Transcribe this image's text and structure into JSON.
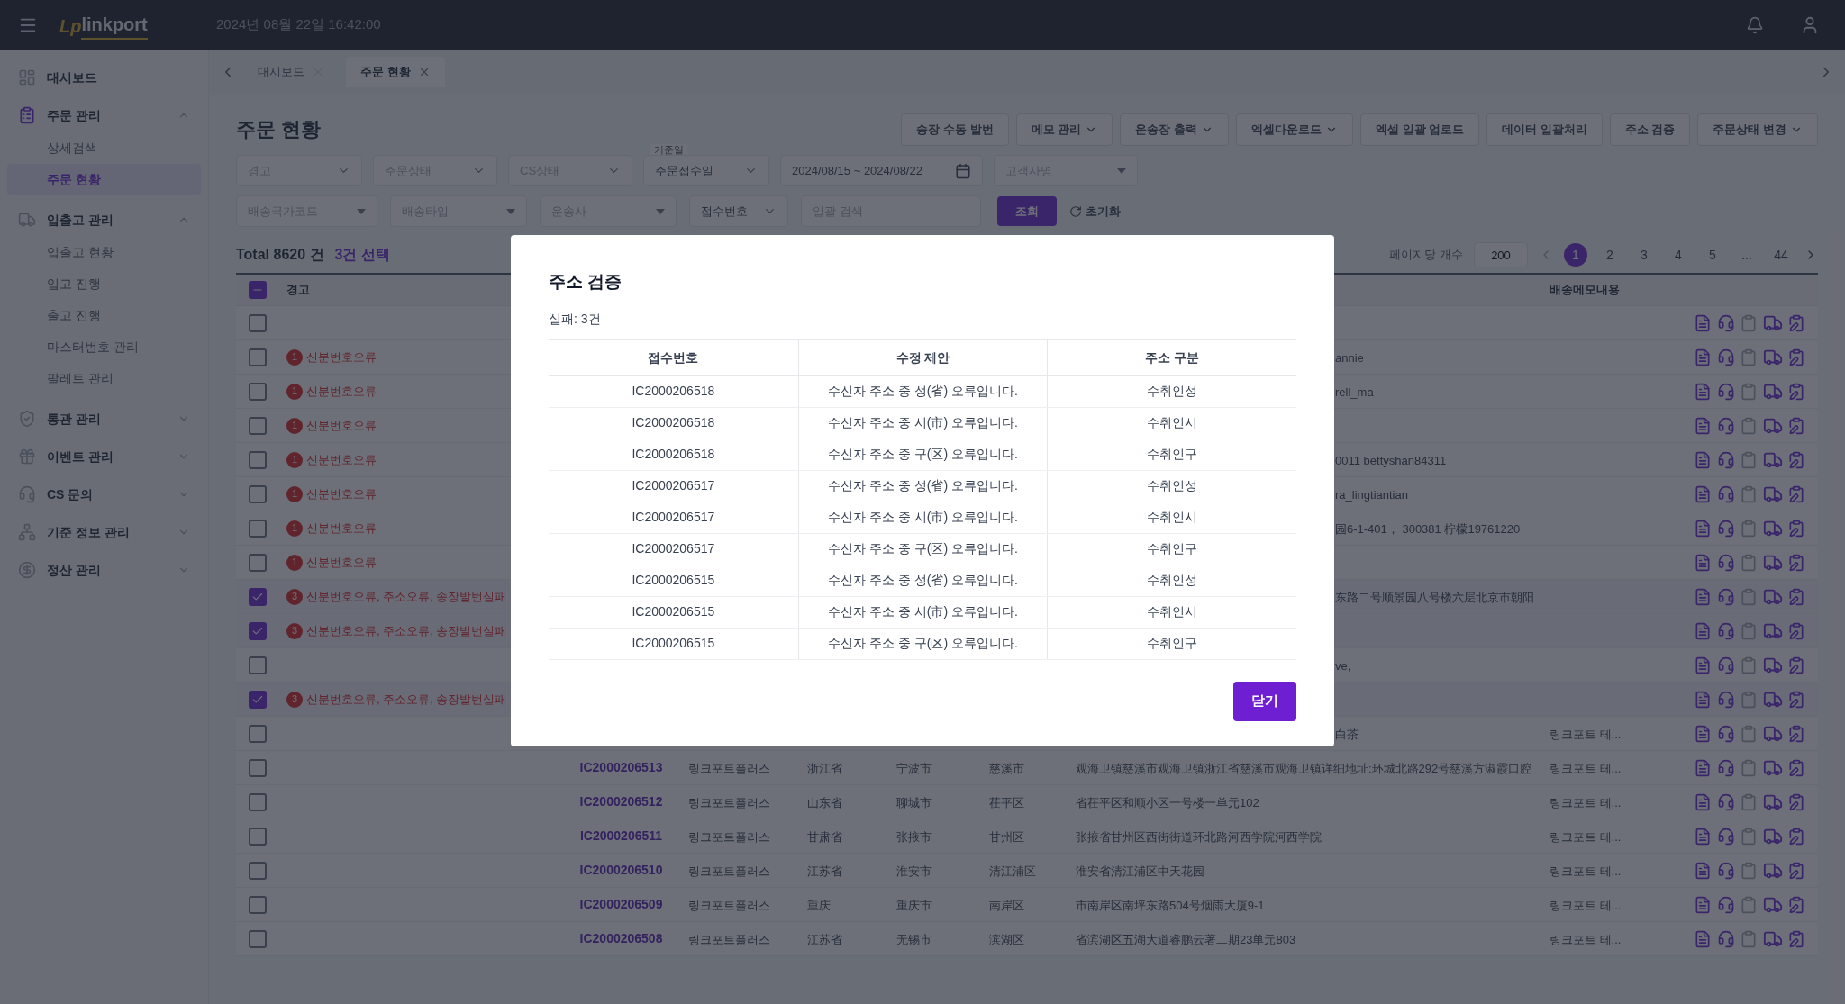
{
  "header": {
    "logo_mark": "Lp",
    "logo_name": "linkport",
    "datetime": "2024년 08월 22일 16:42:00"
  },
  "sidebar": {
    "items": [
      {
        "kind": "link",
        "label": "대시보드"
      },
      {
        "kind": "group",
        "label": "주문 관리",
        "expanded": true,
        "children": [
          {
            "label": "상세검색",
            "selected": false
          },
          {
            "label": "주문 현황",
            "selected": true
          }
        ]
      },
      {
        "kind": "group",
        "label": "입출고 관리",
        "expanded": true,
        "children": [
          {
            "label": "입출고 현황",
            "selected": false
          },
          {
            "label": "입고 진행",
            "selected": false
          },
          {
            "label": "출고 진행",
            "selected": false
          },
          {
            "label": "마스터번호 관리",
            "selected": false
          },
          {
            "label": "팔레트 관리",
            "selected": false
          }
        ]
      },
      {
        "kind": "group",
        "label": "통관 관리",
        "expanded": false
      },
      {
        "kind": "group",
        "label": "이벤트 관리",
        "expanded": false
      },
      {
        "kind": "group",
        "label": "CS 문의",
        "expanded": false
      },
      {
        "kind": "group",
        "label": "기준 정보 관리",
        "expanded": false
      },
      {
        "kind": "group",
        "label": "정산 관리",
        "expanded": false
      }
    ]
  },
  "tabs": [
    {
      "label": "대시보드",
      "selected": false
    },
    {
      "label": "주문 현황",
      "selected": true
    }
  ],
  "page_title": "주문 현황",
  "toolbar": [
    {
      "label": "송장 수동 발번",
      "menu": false
    },
    {
      "label": "메모 관리",
      "menu": true
    },
    {
      "label": "운송장 출력",
      "menu": true
    },
    {
      "label": "엑셀다운로드",
      "menu": true
    },
    {
      "label": "엑셀 일괄 업로드",
      "menu": false
    },
    {
      "label": "데이터 일괄처리",
      "menu": false
    },
    {
      "label": "주소 검증",
      "menu": false
    },
    {
      "label": "주문상태 변경",
      "menu": true
    }
  ],
  "filters_row_1": [
    {
      "kind": "select",
      "placeholder": "경고"
    },
    {
      "kind": "select",
      "placeholder": "주문상태"
    },
    {
      "kind": "select",
      "placeholder": "CS상태"
    },
    {
      "kind": "labeled",
      "label": "기준일",
      "value": "주문접수일"
    },
    {
      "kind": "date",
      "value": "2024/08/15 ~ 2024/08/22"
    },
    {
      "kind": "dropdown",
      "placeholder": "고객사명"
    }
  ],
  "filters_row_2": [
    {
      "kind": "dropdown",
      "placeholder": "배송국가코드"
    },
    {
      "kind": "dropdown",
      "placeholder": "배송타입"
    },
    {
      "kind": "dropdown",
      "placeholder": "운송사"
    },
    {
      "kind": "value",
      "value": "접수번호"
    },
    {
      "kind": "input",
      "placeholder": "일괄 검색"
    }
  ],
  "search_button": "조회",
  "reset_button": "초기화",
  "summary": {
    "total": "Total 8620 건",
    "selected": "3건 선택"
  },
  "pagination": {
    "page_size_label": "페이지당 개수",
    "page_size": "200",
    "pages": [
      {
        "label": "1",
        "selected": true
      },
      {
        "label": "2",
        "selected": false
      },
      {
        "label": "3",
        "selected": false
      },
      {
        "label": "4",
        "selected": false
      },
      {
        "label": "5",
        "selected": false
      },
      {
        "label": "...",
        "selected": false
      },
      {
        "label": "44",
        "selected": false
      }
    ]
  },
  "table": {
    "header_checkbox": {
      "indeterminate": true
    },
    "columns": {
      "warning": "경고",
      "memo": "배송메모내용"
    },
    "rows": [
      {
        "kind": "covered",
        "checked": false
      },
      {
        "kind": "covered",
        "checked": false,
        "warning": {
          "count": "1",
          "text": "신분번호오류"
        },
        "address": "annie"
      },
      {
        "kind": "covered",
        "checked": false,
        "warning": {
          "count": "1",
          "text": "신분번호오류"
        },
        "address": "rell_ma"
      },
      {
        "kind": "covered",
        "checked": false,
        "warning": {
          "count": "1",
          "text": "신분번호오류"
        }
      },
      {
        "kind": "covered",
        "checked": false,
        "warning": {
          "count": "1",
          "text": "신분번호오류"
        },
        "address": "0011 bettyshan84311"
      },
      {
        "kind": "covered",
        "checked": false,
        "warning": {
          "count": "1",
          "text": "신분번호오류"
        },
        "address": "ra_lingtiantian"
      },
      {
        "kind": "covered",
        "checked": false,
        "warning": {
          "count": "1",
          "text": "신분번호오류"
        },
        "address": "园6-1-401， 300381 柠檬19761220"
      },
      {
        "kind": "covered",
        "checked": false,
        "warning": {
          "count": "1",
          "text": "신분번호오류"
        }
      },
      {
        "kind": "covered",
        "checked": true,
        "warning": {
          "count": "3",
          "text": "신분번호오류, 주소오류, 송장발번실패"
        },
        "address": "东路二号顺景园八号楼六层北京市朝阳"
      },
      {
        "kind": "covered",
        "checked": true,
        "warning": {
          "count": "3",
          "text": "신분번호오류, 주소오류, 송장발번실패"
        }
      },
      {
        "kind": "covered",
        "checked": false,
        "address": "ve,"
      },
      {
        "kind": "covered",
        "checked": true,
        "warning": {
          "count": "3",
          "text": "신분번호오류, 주소오류, 송장발번실패"
        }
      },
      {
        "kind": "covered",
        "checked": false,
        "address": "白茶",
        "memo": "링크포트 테..."
      },
      {
        "kind": "full",
        "checked": false,
        "receipt": "IC2000206513",
        "company": "링크포트플러스",
        "province": "浙江省",
        "city": "宁波市",
        "district": "慈溪市",
        "address": "观海卫镇慈溪市观海卫镇浙江省慈溪市观海卫镇详细地址:环城北路292号慈溪方淑霞口腔",
        "memo": "링크포트 테..."
      },
      {
        "kind": "full",
        "checked": false,
        "receipt": "IC2000206512",
        "company": "링크포트플러스",
        "province": "山东省",
        "city": "聊城市",
        "district": "茌平区",
        "address": "省茌平区和顺小区一号楼一单元102",
        "memo": "링크포트 테..."
      },
      {
        "kind": "full",
        "checked": false,
        "receipt": "IC2000206511",
        "company": "링크포트플러스",
        "province": "甘肃省",
        "city": "张掖市",
        "district": "甘州区",
        "address": "张掖省甘州区西街街道环北路河西学院河西学院",
        "memo": "링크포트 테..."
      },
      {
        "kind": "full",
        "checked": false,
        "receipt": "IC2000206510",
        "company": "링크포트플러스",
        "province": "江苏省",
        "city": "淮安市",
        "district": "清江浦区",
        "address": "淮安省清江浦区中天花园",
        "memo": "링크포트 테..."
      },
      {
        "kind": "full",
        "checked": false,
        "receipt": "IC2000206509",
        "company": "링크포트플러스",
        "province": "重庆",
        "city": "重庆市",
        "district": "南岸区",
        "address": "市南岸区南坪东路504号烟雨大厦9-1",
        "memo": "링크포트 테..."
      },
      {
        "kind": "full",
        "checked": false,
        "receipt": "IC2000206508",
        "company": "링크포트플러스",
        "province": "江苏省",
        "city": "无锡市",
        "district": "滨湖区",
        "address": "省滨湖区五湖大道睿鹏云著二期23单元803",
        "memo": "링크포트 테..."
      }
    ]
  },
  "dialog": {
    "title": "주소 검증",
    "summary": "실패: 3건",
    "columns": [
      "접수번호",
      "수정 제안",
      "주소 구분"
    ],
    "rows": [
      [
        "IC2000206518",
        "수신자 주소 중 성(省) 오류입니다.",
        "수취인성"
      ],
      [
        "IC2000206518",
        "수신자 주소 중 시(市) 오류입니다.",
        "수취인시"
      ],
      [
        "IC2000206518",
        "수신자 주소 중 구(区) 오류입니다.",
        "수취인구"
      ],
      [
        "IC2000206517",
        "수신자 주소 중 성(省) 오류입니다.",
        "수취인성"
      ],
      [
        "IC2000206517",
        "수신자 주소 중 시(市) 오류입니다.",
        "수취인시"
      ],
      [
        "IC2000206517",
        "수신자 주소 중 구(区) 오류입니다.",
        "수취인구"
      ],
      [
        "IC2000206515",
        "수신자 주소 중 성(省) 오류입니다.",
        "수취인성"
      ],
      [
        "IC2000206515",
        "수신자 주소 중 시(市) 오류입니다.",
        "수취인시"
      ],
      [
        "IC2000206515",
        "수신자 주소 중 구(区) 오류입니다.",
        "수취인구"
      ]
    ],
    "close_button": "닫기"
  }
}
